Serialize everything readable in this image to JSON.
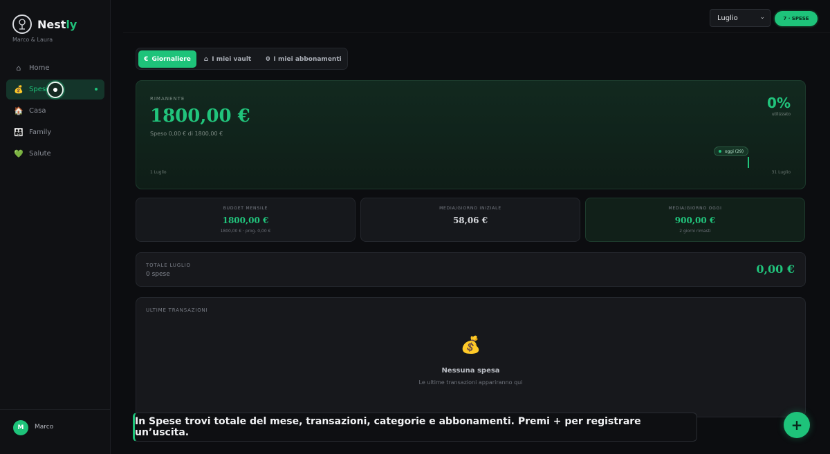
{
  "app": {
    "name_prefix": "Nest",
    "name_accent": "ly",
    "subtitle": "Marco & Laura",
    "logo_icon": "tree-icon",
    "accent_color": "#1ec37a"
  },
  "sidebar": {
    "items": [
      {
        "icon": "⌂",
        "icon_name": "home-icon",
        "label": "Home"
      },
      {
        "icon": "💰",
        "icon_name": "money-bag-icon",
        "label": "Spese",
        "active": true
      },
      {
        "icon": "🏠",
        "icon_name": "house-icon",
        "label": "Casa"
      },
      {
        "icon": "👨‍👩‍👧",
        "icon_name": "family-icon",
        "label": "Family"
      },
      {
        "icon": "💚",
        "icon_name": "green-heart-icon",
        "label": "Salute"
      }
    ],
    "user": {
      "initial": "M",
      "name": "Marco"
    }
  },
  "header": {
    "month_select": {
      "value": "Luglio",
      "chevron": "⌄"
    },
    "badge": "7 · SPESE"
  },
  "tabs": [
    {
      "icon": "€",
      "label": "Giornaliere",
      "active": true
    },
    {
      "icon": "⌂",
      "label": "I miei vault"
    },
    {
      "icon": "0",
      "label": "I miei abbonamenti"
    }
  ],
  "hero": {
    "label": "RIMANENTE",
    "amount": "1800,00 €",
    "sub": "Speso 0,00 € di 1800,00 €",
    "percent": "0%",
    "percent_label": "utilizzato",
    "today_chip": "oggi (29)",
    "start_label": "1 Luglio",
    "end_label": "31 Luglio"
  },
  "stats": [
    {
      "label": "BUDGET MENSILE",
      "value": "1800,00 €",
      "note": "1800,00 € · prog. 0,00 €"
    },
    {
      "label": "MEDIA/GIORNO INIZIALE",
      "value": "58,06 €",
      "note": ""
    },
    {
      "label": "MEDIA/GIORNO OGGI",
      "value": "900,00 €",
      "note": "2 giorni rimasti"
    }
  ],
  "totale": {
    "label": "TOTALE LUGLIO",
    "sub": "0 spese",
    "amount": "0,00 €"
  },
  "transactions": {
    "label": "ULTIME TRANSAZIONI",
    "empty_icon": "💰",
    "empty_title": "Nessuna spesa",
    "empty_hint": "Le ultime transazioni appariranno qui"
  },
  "toast": "In Spese trovi totale del mese, transazioni, categorie e abbonamenti. Premi + per registrare un’uscita.",
  "fab": "+"
}
